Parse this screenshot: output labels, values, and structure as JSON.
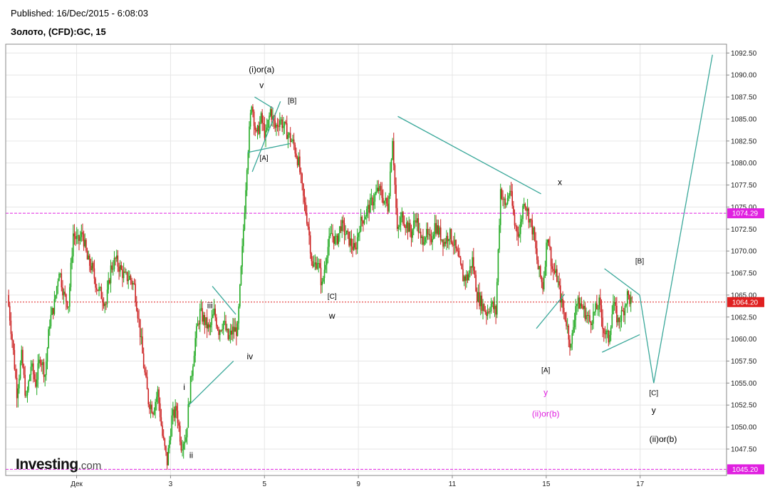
{
  "header": {
    "published": "Published: 16/Dec/2015 - 6:08:03",
    "symbol": "Золото, (CFD):GC, 15"
  },
  "logo": {
    "brand": "Investing",
    "tld": ".com",
    "icon": "investing-swoosh-icon"
  },
  "colors": {
    "up": "#22aa22",
    "down": "#cc2222",
    "trendline": "#3aa89a",
    "level_line": "#e020e0",
    "price_badge": "#e02020",
    "grid": "#e6e6e6"
  },
  "chart_data": {
    "type": "candlestick",
    "title": "Золото, (CFD):GC, 15",
    "ylim": [
      1044.5,
      1093.5
    ],
    "y_ticks": [
      "1092.50",
      "1090.00",
      "1087.50",
      "1085.00",
      "1082.50",
      "1080.00",
      "1077.50",
      "1075.00",
      "1072.50",
      "1070.00",
      "1067.50",
      "1065.00",
      "1062.50",
      "1060.00",
      "1057.50",
      "1055.00",
      "1052.50",
      "1050.00",
      "1047.50",
      "1045.00"
    ],
    "x_ticks": [
      {
        "label": "Дек",
        "pos": 0.16
      },
      {
        "label": "3",
        "pos": 2.16
      },
      {
        "label": "5",
        "pos": 4.16
      },
      {
        "label": "9",
        "pos": 6.16
      },
      {
        "label": "11",
        "pos": 8.16
      },
      {
        "label": "15",
        "pos": 10.16
      },
      {
        "label": "17",
        "pos": 12.16
      }
    ],
    "grid": true,
    "horizontal_levels": [
      {
        "value": 1074.29,
        "label": "1074.29",
        "style": "dashed-magenta"
      },
      {
        "value": 1064.2,
        "label": "1064.20",
        "style": "dotted-red"
      },
      {
        "value": 1045.2,
        "label": "1045.20",
        "style": "dashed-magenta"
      }
    ],
    "price_path": [
      [
        -1.3,
        1065
      ],
      [
        -1.2,
        1060
      ],
      [
        -1.1,
        1054
      ],
      [
        -1.0,
        1058
      ],
      [
        -0.9,
        1053
      ],
      [
        -0.8,
        1057
      ],
      [
        -0.7,
        1055
      ],
      [
        -0.6,
        1058
      ],
      [
        -0.5,
        1056
      ],
      [
        -0.4,
        1062
      ],
      [
        -0.3,
        1064
      ],
      [
        -0.2,
        1068
      ],
      [
        -0.1,
        1065
      ],
      [
        0.0,
        1064
      ],
      [
        0.1,
        1072
      ],
      [
        0.2,
        1071
      ],
      [
        0.3,
        1072
      ],
      [
        0.4,
        1069
      ],
      [
        0.5,
        1068
      ],
      [
        0.6,
        1066
      ],
      [
        0.7,
        1065
      ],
      [
        0.8,
        1064
      ],
      [
        0.9,
        1068
      ],
      [
        1.0,
        1069
      ],
      [
        1.1,
        1068
      ],
      [
        1.2,
        1067
      ],
      [
        1.3,
        1067
      ],
      [
        1.4,
        1066
      ],
      [
        1.5,
        1062
      ],
      [
        1.6,
        1057
      ],
      [
        1.7,
        1053
      ],
      [
        1.8,
        1052
      ],
      [
        1.9,
        1054
      ],
      [
        2.0,
        1049
      ],
      [
        2.1,
        1046
      ],
      [
        2.2,
        1051
      ],
      [
        2.3,
        1052
      ],
      [
        2.4,
        1048
      ],
      [
        2.5,
        1049
      ],
      [
        2.6,
        1055
      ],
      [
        2.7,
        1060
      ],
      [
        2.8,
        1063
      ],
      [
        2.9,
        1062
      ],
      [
        3.0,
        1061
      ],
      [
        3.1,
        1063
      ],
      [
        3.2,
        1061
      ],
      [
        3.3,
        1062
      ],
      [
        3.4,
        1060
      ],
      [
        3.5,
        1061
      ],
      [
        3.6,
        1061
      ],
      [
        3.7,
        1070
      ],
      [
        3.8,
        1080
      ],
      [
        3.9,
        1087
      ],
      [
        4.0,
        1083
      ],
      [
        4.1,
        1085
      ],
      [
        4.2,
        1083
      ],
      [
        4.3,
        1086
      ],
      [
        4.4,
        1084
      ],
      [
        4.5,
        1085
      ],
      [
        4.6,
        1084
      ],
      [
        4.7,
        1083
      ],
      [
        4.8,
        1082
      ],
      [
        4.9,
        1080
      ],
      [
        5.0,
        1076
      ],
      [
        5.1,
        1073
      ],
      [
        5.2,
        1068
      ],
      [
        5.3,
        1069
      ],
      [
        5.4,
        1066
      ],
      [
        5.5,
        1070
      ],
      [
        5.6,
        1072
      ],
      [
        5.7,
        1071
      ],
      [
        5.8,
        1073
      ],
      [
        5.9,
        1072
      ],
      [
        6.0,
        1071
      ],
      [
        6.1,
        1070
      ],
      [
        6.2,
        1073
      ],
      [
        6.3,
        1074
      ],
      [
        6.4,
        1075
      ],
      [
        6.5,
        1076
      ],
      [
        6.6,
        1077
      ],
      [
        6.7,
        1076
      ],
      [
        6.8,
        1075
      ],
      [
        6.9,
        1083
      ],
      [
        7.0,
        1072
      ],
      [
        7.1,
        1074
      ],
      [
        7.2,
        1073
      ],
      [
        7.3,
        1072
      ],
      [
        7.4,
        1074
      ],
      [
        7.5,
        1071
      ],
      [
        7.6,
        1072
      ],
      [
        7.7,
        1071
      ],
      [
        7.8,
        1073
      ],
      [
        7.9,
        1072
      ],
      [
        8.0,
        1071
      ],
      [
        8.1,
        1072
      ],
      [
        8.2,
        1071
      ],
      [
        8.3,
        1069
      ],
      [
        8.4,
        1067
      ],
      [
        8.5,
        1067
      ],
      [
        8.6,
        1069
      ],
      [
        8.7,
        1065
      ],
      [
        8.8,
        1064
      ],
      [
        8.9,
        1063
      ],
      [
        9.0,
        1064
      ],
      [
        9.1,
        1063
      ],
      [
        9.2,
        1077
      ],
      [
        9.3,
        1075
      ],
      [
        9.4,
        1077
      ],
      [
        9.5,
        1073
      ],
      [
        9.6,
        1072
      ],
      [
        9.7,
        1076
      ],
      [
        9.8,
        1074
      ],
      [
        9.9,
        1072
      ],
      [
        10.0,
        1068
      ],
      [
        10.1,
        1066
      ],
      [
        10.2,
        1072
      ],
      [
        10.3,
        1068
      ],
      [
        10.4,
        1067
      ],
      [
        10.5,
        1064
      ],
      [
        10.6,
        1062
      ],
      [
        10.7,
        1059
      ],
      [
        10.8,
        1064
      ],
      [
        10.9,
        1064
      ],
      [
        11.0,
        1063
      ],
      [
        11.1,
        1062
      ],
      [
        11.2,
        1063
      ],
      [
        11.3,
        1064
      ],
      [
        11.4,
        1061
      ],
      [
        11.5,
        1060
      ],
      [
        11.6,
        1064
      ],
      [
        11.7,
        1062
      ],
      [
        11.8,
        1063
      ],
      [
        11.9,
        1065
      ],
      [
        12.0,
        1064
      ]
    ],
    "trendlines": [
      {
        "points": [
          [
            2.55,
            1052.5
          ],
          [
            3.5,
            1057.5
          ]
        ]
      },
      {
        "points": [
          [
            3.05,
            1066
          ],
          [
            3.55,
            1062.8
          ]
        ]
      },
      {
        "points": [
          [
            3.9,
            1079
          ],
          [
            4.5,
            1087
          ]
        ]
      },
      {
        "points": [
          [
            3.95,
            1087.5
          ],
          [
            4.35,
            1086.2
          ]
        ]
      },
      {
        "points": [
          [
            3.8,
            1081.2
          ],
          [
            4.7,
            1082.2
          ]
        ]
      },
      {
        "points": [
          [
            7.0,
            1085.3
          ],
          [
            10.05,
            1076.5
          ]
        ]
      },
      {
        "points": [
          [
            9.95,
            1061.2
          ],
          [
            10.55,
            1065.1
          ]
        ]
      },
      {
        "points": [
          [
            11.35,
            1058.5
          ],
          [
            12.15,
            1060.5
          ]
        ]
      },
      {
        "points": [
          [
            11.4,
            1068
          ],
          [
            12.15,
            1065
          ]
        ]
      },
      {
        "points": [
          [
            12.15,
            1065
          ],
          [
            12.45,
            1055
          ]
        ]
      },
      {
        "points": [
          [
            12.45,
            1055
          ],
          [
            13.7,
            1092.3
          ]
        ]
      }
    ],
    "wave_labels": [
      {
        "text": "(i)or(a)",
        "x": 4.1,
        "y": 1090.3,
        "color": "black",
        "size": "large"
      },
      {
        "text": "v",
        "x": 4.1,
        "y": 1088.5,
        "color": "black",
        "size": "large"
      },
      {
        "text": "[B]",
        "x": 4.75,
        "y": 1086.8,
        "color": "black",
        "size": "small"
      },
      {
        "text": "[A]",
        "x": 4.15,
        "y": 1080.3,
        "color": "black",
        "size": "small"
      },
      {
        "text": "iii",
        "x": 3.0,
        "y": 1063.5,
        "color": "black",
        "size": "large"
      },
      {
        "text": "iv",
        "x": 3.85,
        "y": 1057.7,
        "color": "black",
        "size": "large"
      },
      {
        "text": "i",
        "x": 2.45,
        "y": 1054.2,
        "color": "black",
        "size": "large"
      },
      {
        "text": "ii",
        "x": 2.6,
        "y": 1046.5,
        "color": "black",
        "size": "large"
      },
      {
        "text": "[C]",
        "x": 5.6,
        "y": 1064.6,
        "color": "black",
        "size": "small"
      },
      {
        "text": "w",
        "x": 5.6,
        "y": 1062.3,
        "color": "black",
        "size": "large"
      },
      {
        "text": "x",
        "x": 10.45,
        "y": 1077.5,
        "color": "black",
        "size": "large"
      },
      {
        "text": "[B]",
        "x": 12.15,
        "y": 1068.6,
        "color": "black",
        "size": "small"
      },
      {
        "text": "[A]",
        "x": 10.15,
        "y": 1056.2,
        "color": "black",
        "size": "small"
      },
      {
        "text": "y",
        "x": 10.15,
        "y": 1053.6,
        "color": "magenta",
        "size": "large"
      },
      {
        "text": "(ii)or(b)",
        "x": 10.15,
        "y": 1051.2,
        "color": "magenta",
        "size": "large"
      },
      {
        "text": "[C]",
        "x": 12.45,
        "y": 1053.6,
        "color": "black",
        "size": "small"
      },
      {
        "text": "y",
        "x": 12.45,
        "y": 1051.6,
        "color": "black",
        "size": "large"
      },
      {
        "text": "(ii)or(b)",
        "x": 12.65,
        "y": 1048.3,
        "color": "black",
        "size": "large"
      }
    ]
  }
}
